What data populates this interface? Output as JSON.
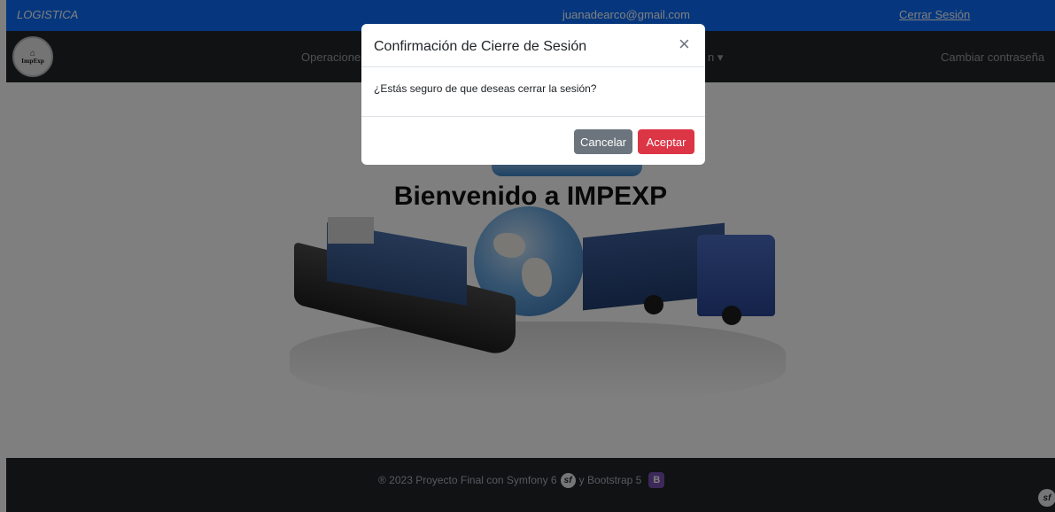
{
  "topbar": {
    "brand": "LOGISTICA",
    "email": "juanadearco@gmail.com",
    "logout": "Cerrar Sesión"
  },
  "navbar": {
    "logo_text": "ImpExp",
    "items": {
      "operations": "Operaciones",
      "dropdown_partial": "n ▾",
      "change_password": "Cambiar contraseña"
    }
  },
  "hero": {
    "title": "Bienvenido a IMPEXP"
  },
  "modal": {
    "title": "Confirmación de Cierre de Sesión",
    "close": "×",
    "body": "¿Estás seguro de que deseas cerrar la sesión?",
    "cancel": "Cancelar",
    "accept": "Aceptar"
  },
  "footer": {
    "text_prefix": "® 2023 Proyecto Final con Symfony 6",
    "text_middle": "y Bootstrap 5",
    "symfony_glyph": "sf",
    "bootstrap_glyph": "B"
  },
  "colors": {
    "primary": "#0d6efd",
    "dark": "#212529",
    "danger": "#dc3545",
    "secondary": "#6c757d",
    "bootstrap_purple": "#7952b3"
  }
}
